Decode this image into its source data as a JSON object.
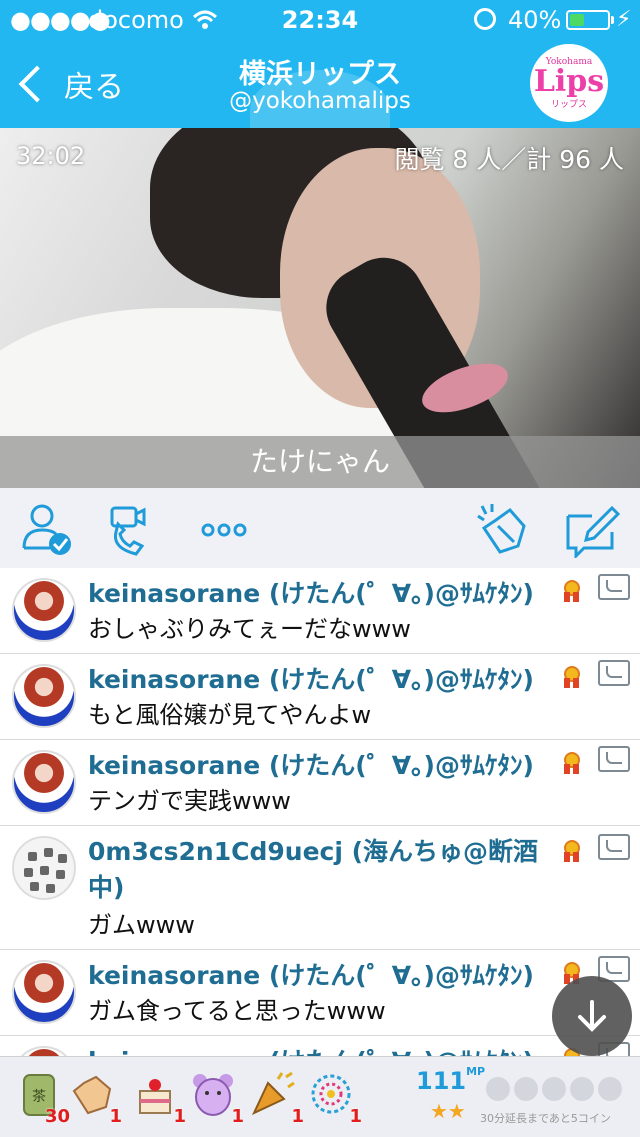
{
  "status_bar": {
    "signal_dots": "●●●●●",
    "carrier": "docomo",
    "time": "22:34",
    "battery_percent": "40%",
    "battery_level": 0.4
  },
  "header": {
    "back_label": "戻る",
    "title": "横浜リップス",
    "handle": "@yokohamalips",
    "logo": {
      "top": "Yokohama",
      "main": "Lips",
      "bottom": "リップス"
    }
  },
  "video": {
    "elapsed": "32:02",
    "viewers": "閲覧 8 人／計 96 人",
    "caption": "たけにゃん"
  },
  "toolbar": {
    "icons": [
      "follow-user-icon",
      "video-call-icon",
      "more-icon",
      "clap-icon",
      "compose-icon"
    ],
    "accent": "#1e9bd8"
  },
  "comments": [
    {
      "user": "keinasorane (けたん(゜∀。)@ｻﾑｹﾀﾝ)",
      "text": "おしゃぶりみてぇーだなwww",
      "avatar": "girl"
    },
    {
      "user": "keinasorane (けたん(゜∀。)@ｻﾑｹﾀﾝ)",
      "text": "もと風俗嬢が見てやんよw",
      "avatar": "girl"
    },
    {
      "user": "keinasorane (けたん(゜∀。)@ｻﾑｹﾀﾝ)",
      "text": "テンガで実践www",
      "avatar": "girl"
    },
    {
      "user": "0m3cs2n1Cd9uecj (海んちゅ@断酒中)",
      "text": "ガムwww",
      "avatar": "pattern"
    },
    {
      "user": "keinasorane (けたん(゜∀。)@ｻﾑｹﾀﾝ)",
      "text": "ガム食ってると思ったwww",
      "avatar": "girl"
    },
    {
      "user": "keinasorane (けたん(゜∀。)@ｻﾑｹﾀﾝ)",
      "text": "",
      "avatar": "girl"
    }
  ],
  "gifts": [
    {
      "name": "tea-icon",
      "count": "30"
    },
    {
      "name": "clap-gift-icon",
      "count": "1"
    },
    {
      "name": "cake-icon",
      "count": "1"
    },
    {
      "name": "bear-icon",
      "count": "1"
    },
    {
      "name": "party-popper-icon",
      "count": "1"
    },
    {
      "name": "fireworks-icon",
      "count": "1"
    }
  ],
  "mp": {
    "value": "111",
    "unit": "MP",
    "stars": "★★"
  },
  "coins_note": "30分延長まであと5コイン",
  "colors": {
    "header_bg": "#22b7f0",
    "username": "#1f6d93",
    "gift_count": "#e01e1e"
  }
}
